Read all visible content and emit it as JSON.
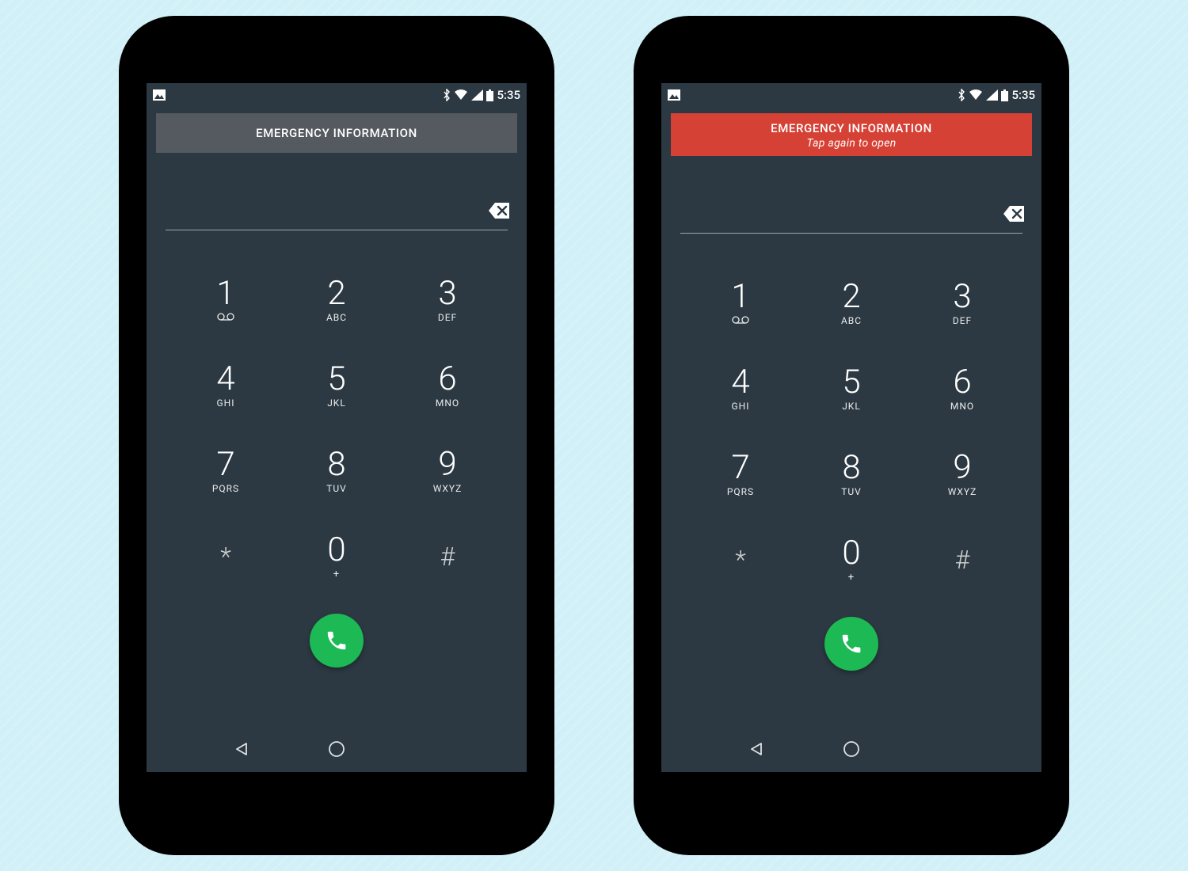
{
  "status": {
    "time": "5:35"
  },
  "phone_left": {
    "banner": {
      "title": "EMERGENCY INFORMATION",
      "style": "normal"
    }
  },
  "phone_right": {
    "banner": {
      "title": "EMERGENCY INFORMATION",
      "subtitle": "Tap again to open",
      "style": "alert"
    }
  },
  "dialpad": {
    "keys": [
      {
        "num": "1",
        "ltr": "voicemail"
      },
      {
        "num": "2",
        "ltr": "ABC"
      },
      {
        "num": "3",
        "ltr": "DEF"
      },
      {
        "num": "4",
        "ltr": "GHI"
      },
      {
        "num": "5",
        "ltr": "JKL"
      },
      {
        "num": "6",
        "ltr": "MNO"
      },
      {
        "num": "7",
        "ltr": "PQRS"
      },
      {
        "num": "8",
        "ltr": "TUV"
      },
      {
        "num": "9",
        "ltr": "WXYZ"
      },
      {
        "num": "*",
        "ltr": ""
      },
      {
        "num": "0",
        "ltr": "+"
      },
      {
        "num": "#",
        "ltr": ""
      }
    ]
  }
}
